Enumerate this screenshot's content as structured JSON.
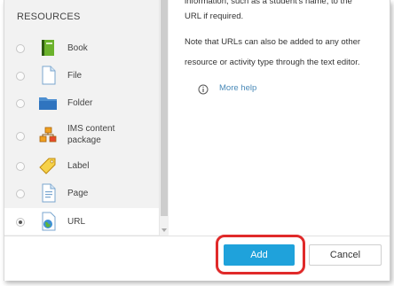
{
  "left_panel": {
    "section_title": "RESOURCES",
    "items": [
      {
        "label": "Book",
        "icon": "book-icon",
        "selected": false
      },
      {
        "label": "File",
        "icon": "file-icon",
        "selected": false
      },
      {
        "label": "Folder",
        "icon": "folder-icon",
        "selected": false
      },
      {
        "label": "IMS content\npackage",
        "icon": "ims-package-icon",
        "selected": false
      },
      {
        "label": "Label",
        "icon": "label-tag-icon",
        "selected": false
      },
      {
        "label": "Page",
        "icon": "page-icon",
        "selected": false
      },
      {
        "label": "URL",
        "icon": "url-globe-icon",
        "selected": true
      }
    ]
  },
  "description": {
    "line1": "information, such as a student's name, to the",
    "line2": "URL if required.",
    "line3": "Note that URLs can also be added to any other",
    "line4": "resource or activity type through the text editor.",
    "more_help": "More help"
  },
  "footer": {
    "add_label": "Add",
    "cancel_label": "Cancel",
    "accent_color": "#1fa2db",
    "highlight_color": "#e02a2a"
  }
}
